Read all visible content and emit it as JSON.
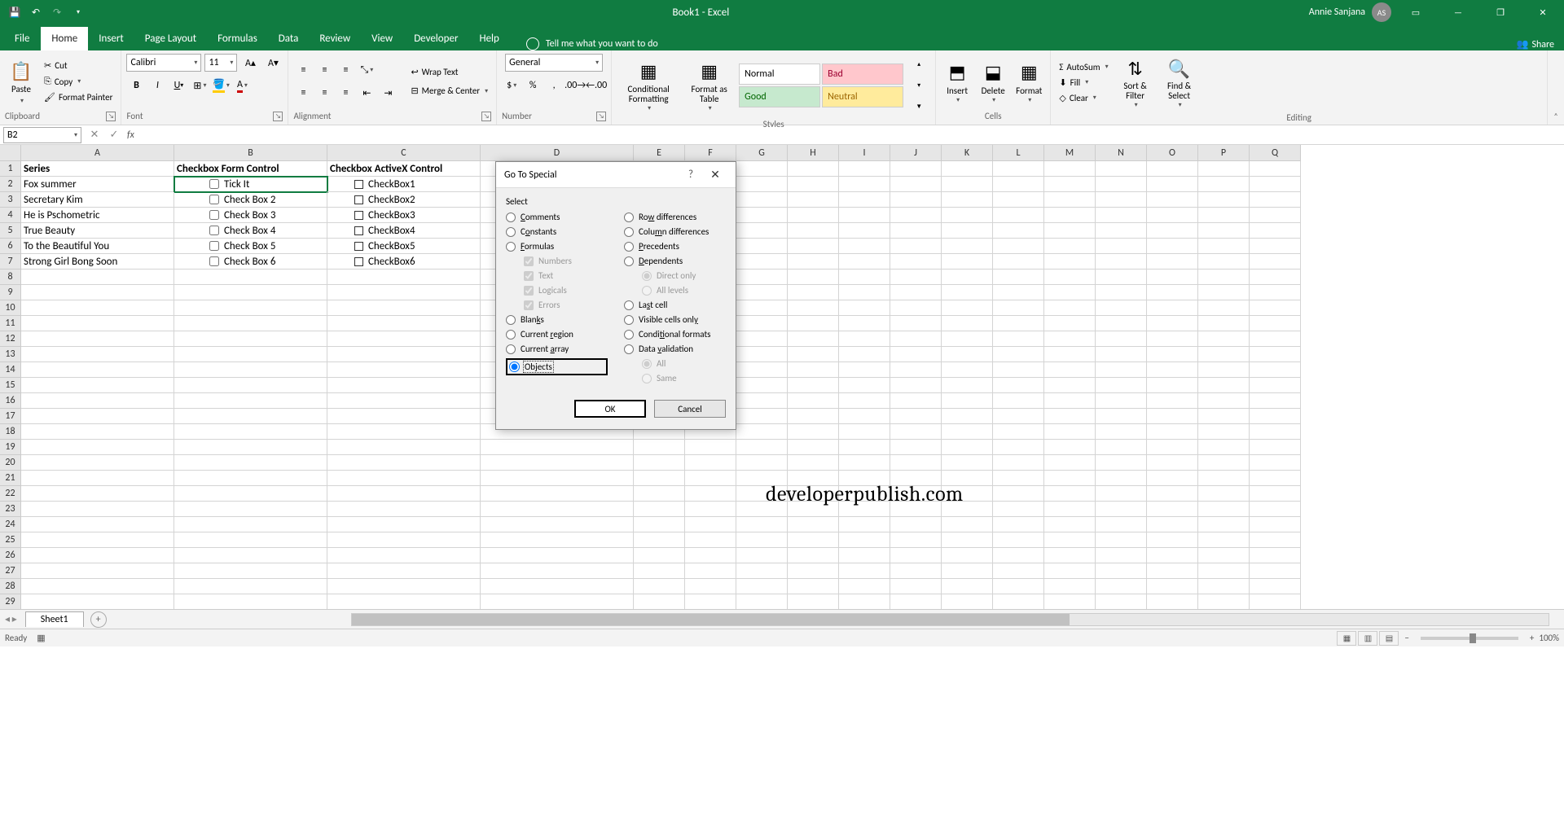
{
  "title": {
    "document": "Book1",
    "app": "Excel",
    "user": "Annie Sanjana",
    "initials": "AS"
  },
  "tabs": [
    "File",
    "Home",
    "Insert",
    "Page Layout",
    "Formulas",
    "Data",
    "Review",
    "View",
    "Developer",
    "Help"
  ],
  "tell_me": "Tell me what you want to do",
  "share": "Share",
  "ribbon": {
    "clipboard": {
      "label": "Clipboard",
      "paste": "Paste",
      "cut": "Cut",
      "copy": "Copy",
      "format_painter": "Format Painter"
    },
    "font": {
      "label": "Font",
      "name": "Calibri",
      "size": "11"
    },
    "alignment": {
      "label": "Alignment",
      "wrap": "Wrap Text",
      "merge": "Merge & Center"
    },
    "number": {
      "label": "Number",
      "format": "General"
    },
    "styles": {
      "label": "Styles",
      "cond": "Conditional Formatting",
      "table": "Format as Table",
      "s1": "Normal",
      "s2": "Bad",
      "s3": "Good",
      "s4": "Neutral"
    },
    "cells": {
      "label": "Cells",
      "insert": "Insert",
      "delete": "Delete",
      "format": "Format"
    },
    "editing": {
      "label": "Editing",
      "autosum": "AutoSum",
      "fill": "Fill",
      "clear": "Clear",
      "sort": "Sort & Filter",
      "find": "Find & Select"
    }
  },
  "name_box": "B2",
  "columns": [
    "A",
    "B",
    "C",
    "D",
    "E",
    "F",
    "G",
    "H",
    "I",
    "J",
    "K",
    "L",
    "M",
    "N",
    "O",
    "P",
    "Q"
  ],
  "headers": {
    "a": "Series",
    "b": "Checkbox Form Control",
    "c": "Checkbox ActiveX Control"
  },
  "series": [
    "Fox summer",
    "Secretary Kim",
    "He is Pschometric",
    "True Beauty",
    "To the Beautiful You",
    "Strong Girl Bong Soon"
  ],
  "form_checks": [
    "Tick It",
    "Check Box 2",
    "Check Box 3",
    "Check Box 4",
    "Check Box 5",
    "Check Box 6"
  ],
  "ax_checks": [
    "CheckBox1",
    "CheckBox2",
    "CheckBox3",
    "CheckBox4",
    "CheckBox5",
    "CheckBox6"
  ],
  "watermark": "developerpublish.com",
  "sheet": "Sheet1",
  "status": {
    "ready": "Ready",
    "zoom": "100%"
  },
  "dialog": {
    "title": "Go To Special",
    "select_label": "Select",
    "left": {
      "comments": "Comments",
      "constants": "Constants",
      "formulas": "Formulas",
      "numbers": "Numbers",
      "text": "Text",
      "logicals": "Logicals",
      "errors": "Errors",
      "blanks": "Blanks",
      "current_region": "Current region",
      "current_array": "Current array",
      "objects": "Objects"
    },
    "right": {
      "row_diff": "Row differences",
      "col_diff": "Column differences",
      "precedents": "Precedents",
      "dependents": "Dependents",
      "direct": "Direct only",
      "all_levels": "All levels",
      "last_cell": "Last cell",
      "visible": "Visible cells only",
      "cond_fmt": "Conditional formats",
      "data_val": "Data validation",
      "all": "All",
      "same": "Same"
    },
    "ok": "OK",
    "cancel": "Cancel"
  }
}
